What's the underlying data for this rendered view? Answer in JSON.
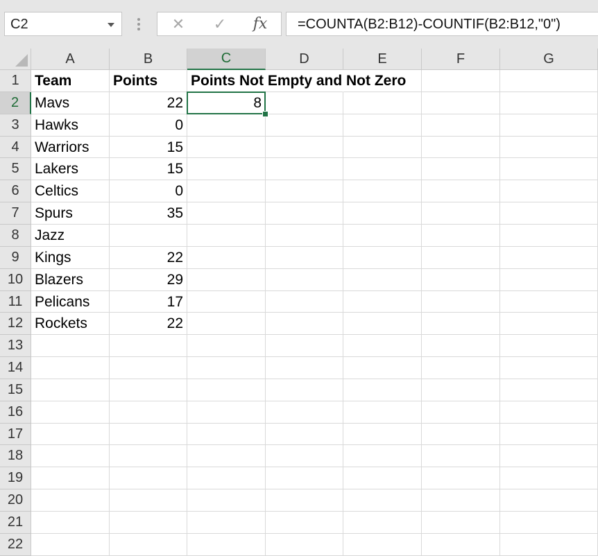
{
  "formula_bar": {
    "name_box": "C2",
    "cancel_icon": "close-icon",
    "enter_icon": "check-icon",
    "function_label": "fx",
    "formula": "=COUNTA(B2:B12)-COUNTIF(B2:B12,\"0\")"
  },
  "sheet": {
    "active_cell": "C2",
    "columns": [
      "A",
      "B",
      "C",
      "D",
      "E",
      "F",
      "G"
    ],
    "rows": [
      "1",
      "2",
      "3",
      "4",
      "5",
      "6",
      "7",
      "8",
      "9",
      "10",
      "11",
      "12",
      "13",
      "14",
      "15",
      "16",
      "17",
      "18",
      "19",
      "20",
      "21",
      "22"
    ],
    "headers": {
      "team": "Team",
      "points": "Points",
      "result": "Points Not Empty and Not Zero"
    },
    "data": [
      {
        "team": "Mavs",
        "points": "22"
      },
      {
        "team": "Hawks",
        "points": "0"
      },
      {
        "team": "Warriors",
        "points": "15"
      },
      {
        "team": "Lakers",
        "points": "15"
      },
      {
        "team": "Celtics",
        "points": "0"
      },
      {
        "team": "Spurs",
        "points": "35"
      },
      {
        "team": "Jazz",
        "points": ""
      },
      {
        "team": "Kings",
        "points": "22"
      },
      {
        "team": "Blazers",
        "points": "29"
      },
      {
        "team": "Pelicans",
        "points": "17"
      },
      {
        "team": "Rockets",
        "points": "22"
      }
    ],
    "result_value": "8"
  }
}
